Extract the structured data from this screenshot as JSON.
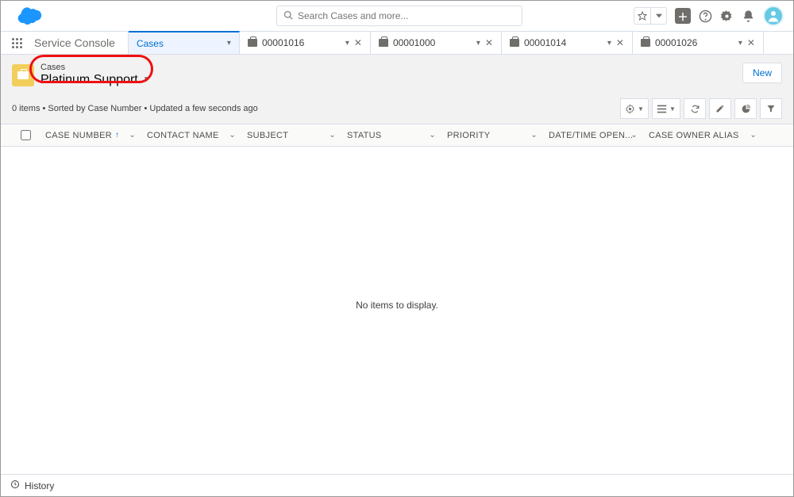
{
  "search": {
    "placeholder": "Search Cases and more..."
  },
  "app_name": "Service Console",
  "tabs": {
    "main": {
      "label": "Cases"
    },
    "workspace": [
      {
        "label": "00001016"
      },
      {
        "label": "00001000"
      },
      {
        "label": "00001014"
      },
      {
        "label": "00001026"
      }
    ]
  },
  "list_view": {
    "object_label": "Cases",
    "name": "Platinum Support",
    "meta": "0 items • Sorted by Case Number • Updated a few seconds ago",
    "new_button": "New",
    "empty_message": "No items to display."
  },
  "columns": {
    "case_number": "CASE NUMBER",
    "contact_name": "CONTACT NAME",
    "subject": "SUBJECT",
    "status": "STATUS",
    "priority": "PRIORITY",
    "datetime_opened": "DATE/TIME OPEN...",
    "owner_alias": "CASE OWNER ALIAS"
  },
  "footer": {
    "history": "History"
  }
}
